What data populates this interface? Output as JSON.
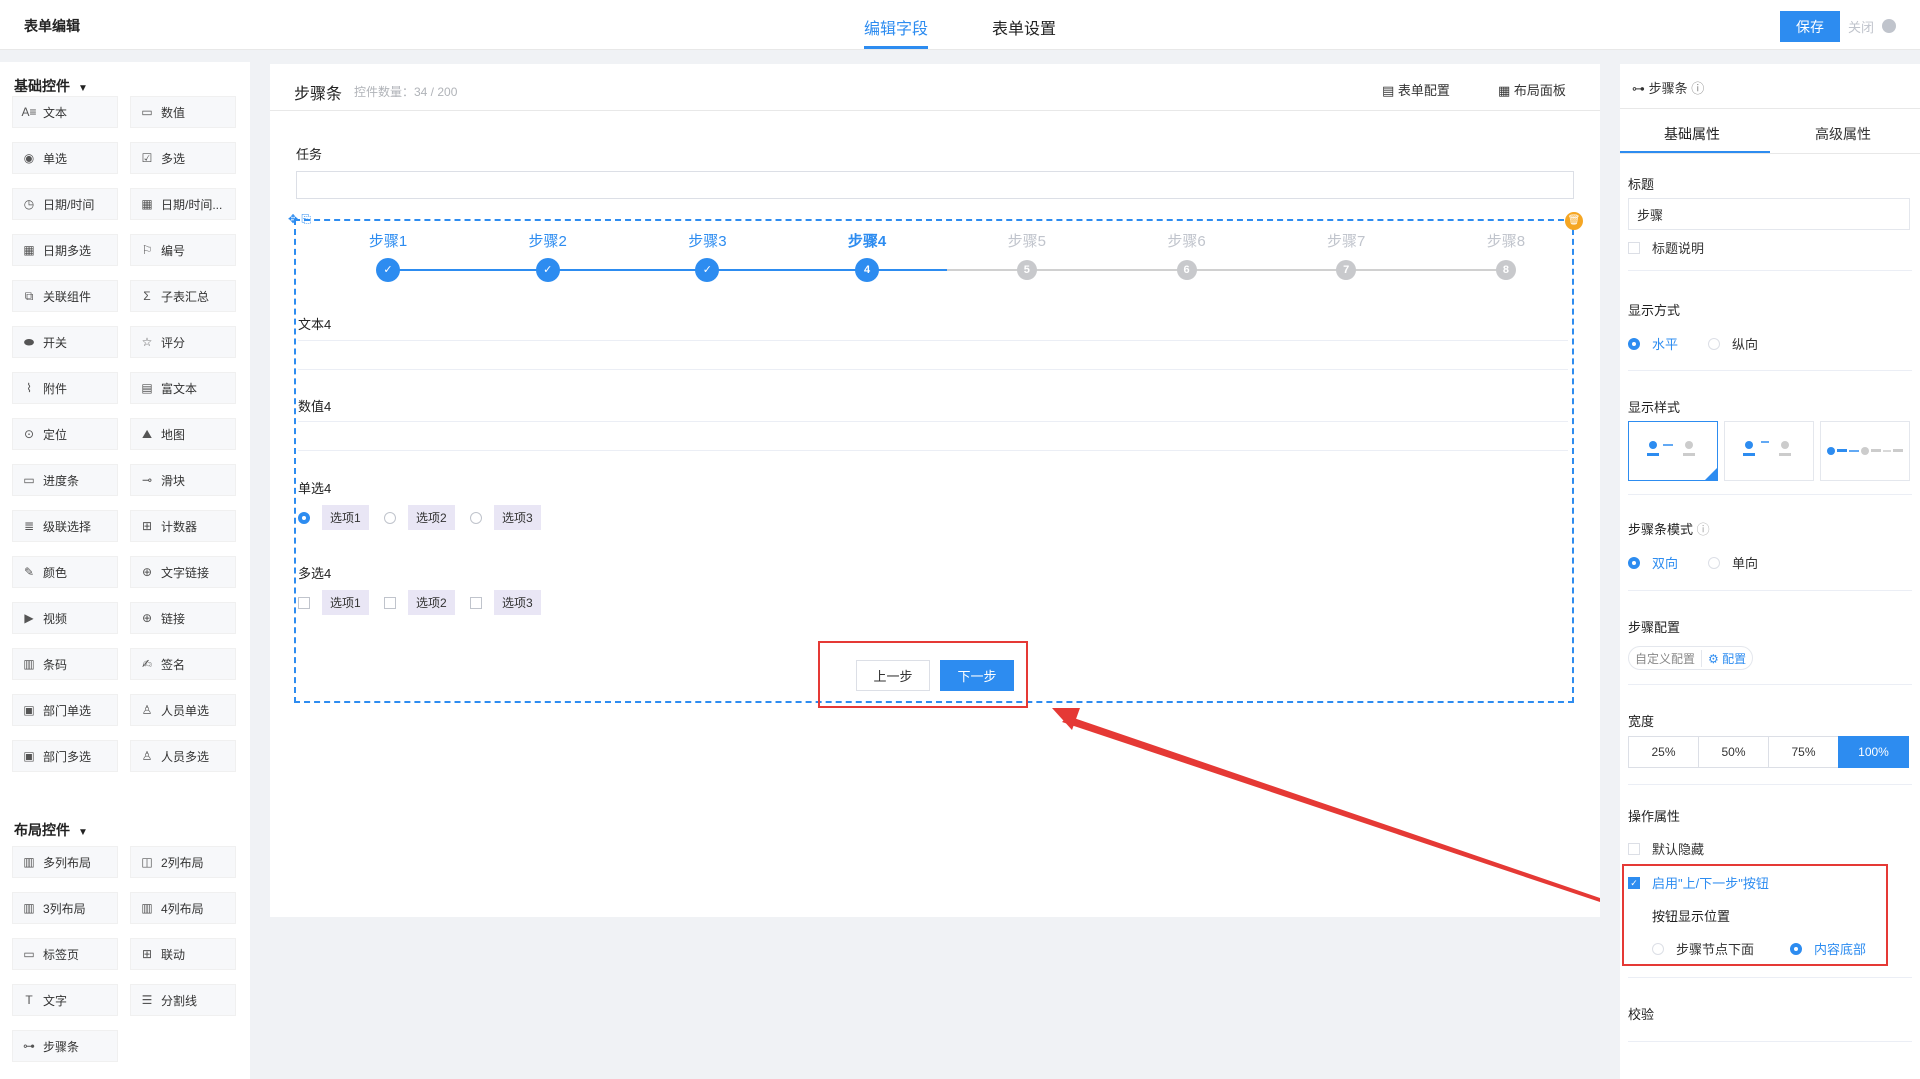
{
  "app": {
    "title": "表单编辑"
  },
  "header": {
    "tabs": [
      {
        "label": "编辑字段"
      },
      {
        "label": "表单设置"
      }
    ],
    "save_label": "保存",
    "close_label": "关闭"
  },
  "palette": {
    "basic_title": "基础控件",
    "basic_items": [
      {
        "label": "文本",
        "icon": "text-icon"
      },
      {
        "label": "数值",
        "icon": "number-icon"
      },
      {
        "label": "单选",
        "icon": "radio-icon"
      },
      {
        "label": "多选",
        "icon": "checkbox-icon"
      },
      {
        "label": "日期/时间",
        "icon": "clock-icon"
      },
      {
        "label": "日期/时间...",
        "icon": "calendar-icon"
      },
      {
        "label": "日期多选",
        "icon": "calendar-multi-icon"
      },
      {
        "label": "编号",
        "icon": "tag-icon"
      },
      {
        "label": "关联组件",
        "icon": "link-box-icon"
      },
      {
        "label": "子表汇总",
        "icon": "sigma-icon"
      },
      {
        "label": "开关",
        "icon": "toggle-icon"
      },
      {
        "label": "评分",
        "icon": "star-icon"
      },
      {
        "label": "附件",
        "icon": "paperclip-icon"
      },
      {
        "label": "富文本",
        "icon": "richtext-icon"
      },
      {
        "label": "定位",
        "icon": "location-icon"
      },
      {
        "label": "地图",
        "icon": "map-icon"
      },
      {
        "label": "进度条",
        "icon": "progress-icon"
      },
      {
        "label": "滑块",
        "icon": "slider-icon"
      },
      {
        "label": "级联选择",
        "icon": "cascade-icon"
      },
      {
        "label": "计数器",
        "icon": "counter-icon"
      },
      {
        "label": "颜色",
        "icon": "color-picker-icon"
      },
      {
        "label": "文字链接",
        "icon": "globe-icon"
      },
      {
        "label": "视频",
        "icon": "video-icon"
      },
      {
        "label": "链接",
        "icon": "globe-link-icon"
      },
      {
        "label": "条码",
        "icon": "barcode-icon"
      },
      {
        "label": "签名",
        "icon": "signature-icon"
      },
      {
        "label": "部门单选",
        "icon": "dept-icon"
      },
      {
        "label": "人员单选",
        "icon": "user-icon"
      },
      {
        "label": "部门多选",
        "icon": "dept-multi-icon"
      },
      {
        "label": "人员多选",
        "icon": "users-icon"
      }
    ],
    "layout_title": "布局控件",
    "layout_items": [
      {
        "label": "多列布局",
        "icon": "columns-icon"
      },
      {
        "label": "2列布局",
        "icon": "two-columns-icon"
      },
      {
        "label": "3列布局",
        "icon": "three-columns-icon"
      },
      {
        "label": "4列布局",
        "icon": "four-columns-icon"
      },
      {
        "label": "标签页",
        "icon": "tabs-icon"
      },
      {
        "label": "联动",
        "icon": "linkage-icon"
      },
      {
        "label": "文字",
        "icon": "type-icon"
      },
      {
        "label": "分割线",
        "icon": "divider-icon"
      },
      {
        "label": "步骤条",
        "icon": "steps-icon"
      }
    ]
  },
  "canvas": {
    "title": "步骤条",
    "count_text": "控件数量：34 / 200",
    "form_config_label": "表单配置",
    "layout_panel_label": "布局面板",
    "task_label": "任务",
    "steps": [
      {
        "label": "步骤1",
        "node": "✓",
        "state": "done"
      },
      {
        "label": "步骤2",
        "node": "✓",
        "state": "done"
      },
      {
        "label": "步骤3",
        "node": "✓",
        "state": "done"
      },
      {
        "label": "步骤4",
        "node": "4",
        "state": "active"
      },
      {
        "label": "步骤5",
        "node": "5",
        "state": "todo"
      },
      {
        "label": "步骤6",
        "node": "6",
        "state": "todo"
      },
      {
        "label": "步骤7",
        "node": "7",
        "state": "todo"
      },
      {
        "label": "步骤8",
        "node": "8",
        "state": "todo"
      }
    ],
    "text_field_label": "文本4",
    "number_field_label": "数值4",
    "radio_field_label": "单选4",
    "radio_options": [
      "选项1",
      "选项2",
      "选项3"
    ],
    "checkbox_field_label": "多选4",
    "checkbox_options": [
      "选项1",
      "选项2",
      "选项3"
    ],
    "prev_label": "上一步",
    "next_label": "下一步"
  },
  "props": {
    "header": "步骤条",
    "tabs": [
      {
        "label": "基础属性"
      },
      {
        "label": "高级属性"
      }
    ],
    "title_label": "标题",
    "title_value": "步骤",
    "title_desc_label": "标题说明",
    "display_mode_label": "显示方式",
    "display_mode_options": [
      "水平",
      "纵向"
    ],
    "display_mode_selected": "水平",
    "display_style_label": "显示样式",
    "step_mode_label": "步骤条模式",
    "step_mode_options": [
      "双向",
      "单向"
    ],
    "step_mode_selected": "双向",
    "step_config_label": "步骤配置",
    "step_config_custom": "自定义配置",
    "step_config_link": "配置",
    "width_label": "宽度",
    "width_options": [
      "25%",
      "50%",
      "75%",
      "100%"
    ],
    "width_selected": "100%",
    "ops_label": "操作属性",
    "default_hidden_label": "默认隐藏",
    "enable_nav_label": "启用\"上/下一步\"按钮",
    "btn_position_label": "按钮显示位置",
    "btn_position_options": [
      "步骤节点下面",
      "内容底部"
    ],
    "btn_position_selected": "内容底部",
    "validation_label": "校验"
  },
  "colors": {
    "primary": "#2d8cf0",
    "annotation": "#e53935",
    "warning": "#f5a623"
  }
}
